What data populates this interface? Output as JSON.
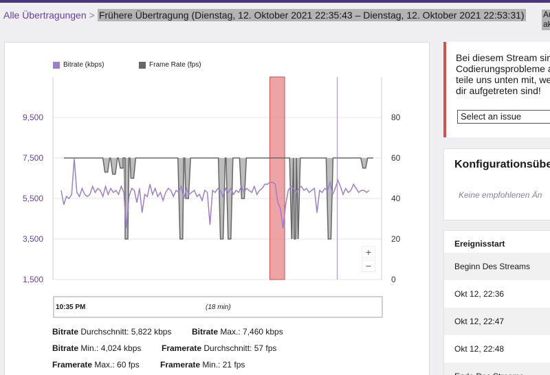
{
  "breadcrumb": {
    "root": "Alle Übertragungen",
    "separator": ">",
    "current": "Frühere Übertragung (Dienstag, 12. Oktober 2021 22:35:43 – Dienstag, 12. Oktober 2021 22:53:31)",
    "right_fragment": "Au ak"
  },
  "colors": {
    "accent": "#6441a4",
    "bitrate": "#9b7fcb",
    "framerate": "#666666",
    "alert": "#d94f4f"
  },
  "legend": {
    "bitrate": "Bitrate (kbps)",
    "framerate": "Frame Rate (fps)"
  },
  "chart_data": {
    "type": "line",
    "left_axis": {
      "ticks": [
        "9,500",
        "7,500",
        "5,500",
        "3,500",
        "1,500"
      ],
      "values": [
        9500,
        7500,
        5500,
        3500,
        1500
      ],
      "range": [
        1500,
        9500
      ]
    },
    "right_axis": {
      "ticks": [
        "80",
        "60",
        "40",
        "20",
        "0"
      ],
      "values": [
        80,
        60,
        40,
        20,
        0
      ],
      "range": [
        0,
        80
      ]
    },
    "framerate_series": {
      "name": "Frame Rate (fps)",
      "baseline": 60,
      "dips": [
        {
          "t": 0.22,
          "min": 53
        },
        {
          "t": 0.26,
          "min": 52
        },
        {
          "t": 0.3,
          "min": 55
        },
        {
          "t": 0.325,
          "min": 20
        },
        {
          "t": 0.355,
          "min": 50
        },
        {
          "t": 0.61,
          "min": 20
        },
        {
          "t": 0.64,
          "min": 40
        },
        {
          "t": 0.82,
          "min": 20
        },
        {
          "t": 0.86,
          "min": 20
        },
        {
          "t": 0.93,
          "min": 40
        },
        {
          "t": 1.19,
          "min": 20
        },
        {
          "t": 1.21,
          "min": 20
        },
        {
          "t": 1.38,
          "min": 20
        },
        {
          "t": 1.56,
          "min": 55
        }
      ]
    },
    "bitrate_series": {
      "name": "Bitrate (kbps)",
      "values": [
        5900,
        5200,
        5600,
        5500,
        5700,
        7460,
        5800,
        5600,
        6000,
        5700,
        5600,
        5700,
        6100,
        5800,
        6000,
        5900,
        5600,
        6100,
        5700,
        6000,
        5800,
        5900,
        5700,
        6100,
        5800,
        4024,
        5600,
        6000,
        5900,
        5300,
        6000,
        4800,
        5700,
        5600,
        6200,
        5700,
        6000,
        5600,
        5800,
        5400,
        5800,
        6000,
        5900,
        5600,
        5900,
        5800,
        6100,
        5500,
        6000,
        5700,
        5800,
        5900,
        5600,
        5700,
        5400,
        5900,
        5800,
        4200,
        5900,
        5800,
        6000,
        5900,
        5600,
        6000,
        5800,
        6000,
        5700,
        5900,
        5800,
        6100,
        5800,
        6000,
        5900,
        5800,
        6100,
        5700,
        5900,
        6000,
        6200,
        6200,
        6300,
        6300,
        6200,
        5300,
        5000,
        4024,
        5200,
        5900,
        6100,
        6000,
        5800,
        6000,
        6100,
        5900,
        6000,
        5800,
        5900,
        6000,
        4800,
        5900,
        5800,
        6000,
        5900,
        6300,
        5700,
        6000,
        6400,
        6100,
        5700,
        6000,
        5800,
        5900,
        6200,
        6000,
        5800,
        5900,
        5900,
        5800,
        5900
      ]
    },
    "highlight": {
      "start_frac": 0.66,
      "end_frac": 0.705
    },
    "marker_frac": 0.865
  },
  "nav": {
    "start_label": "10:35 PM",
    "duration_label": "(18 min)"
  },
  "zoom": {
    "plus": "+",
    "minus": "−"
  },
  "stats": {
    "bitrate_avg_label": "Bitrate",
    "bitrate_avg_text": " Durchschnitt: 5,822 kbps",
    "bitrate_max_label": "Bitrate",
    "bitrate_max_text": " Max.: 7,460 kbps",
    "bitrate_min_label": "Bitrate",
    "bitrate_min_text": " Min.: 4,024 kbps",
    "framerate_avg_label": "Framerate",
    "framerate_avg_text": " Durchschnitt: 57 fps",
    "framerate_max_label": "Framerate",
    "framerate_max_text": " Max.: 60 fps",
    "framerate_min_label": "Framerate",
    "framerate_min_text": " Min.: 21 fps"
  },
  "alert": {
    "line1": "Bei diesem Stream sin",
    "line2": "Codierungsprobleme a",
    "line3": "teile uns unten mit, we",
    "line4": "dir aufgetreten sind!",
    "select_value": "Select an issue"
  },
  "config": {
    "title": "Konfigurationsübe",
    "empty": "Keine empfohlenen Än"
  },
  "events": {
    "header": "Ereignisstart",
    "items": [
      "Beginn Des Streams",
      "Okt 12, 22:36",
      "Okt 12, 22:47",
      "Okt 12, 22:48",
      "Ende Des Streams"
    ]
  }
}
